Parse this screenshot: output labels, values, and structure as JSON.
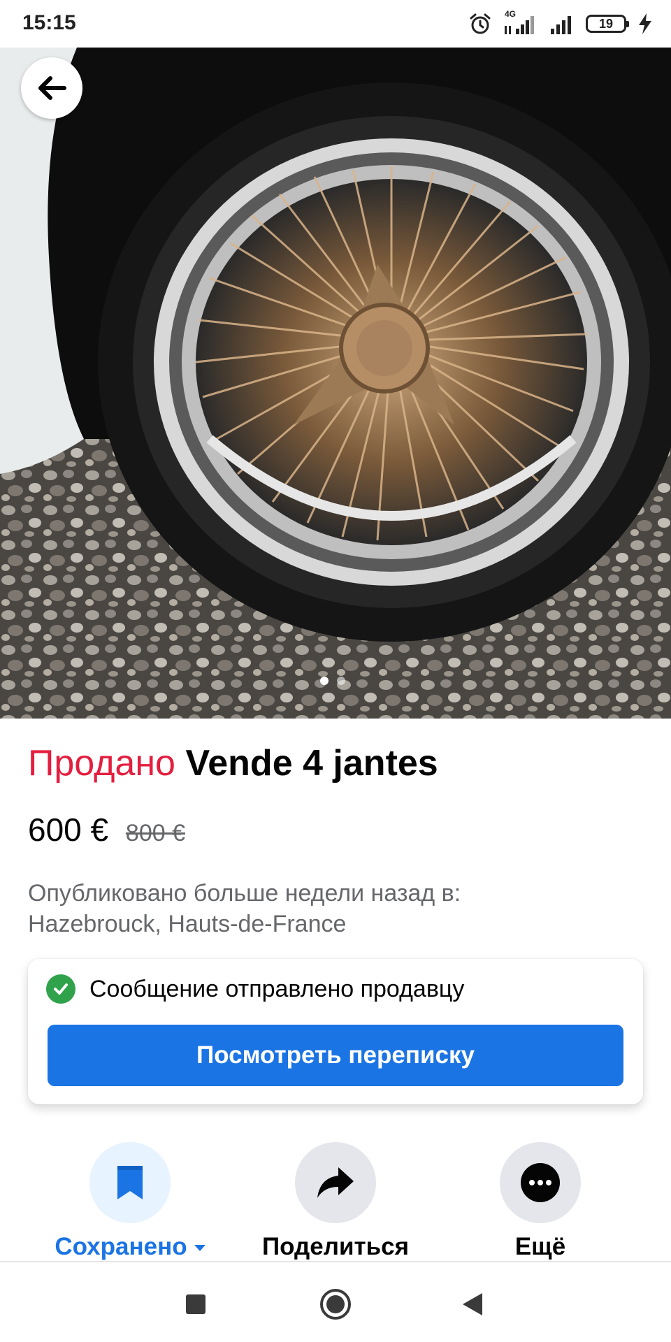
{
  "status_bar": {
    "time": "15:15",
    "network_label": "4G",
    "battery_level": "19",
    "icons": [
      "alarm-icon",
      "signal-4g-icon",
      "signal-icon",
      "battery-icon",
      "charging-icon"
    ]
  },
  "listing": {
    "photo_description_icon": "wheel-photo",
    "photo_page_count": 2,
    "photo_page_active": 1,
    "status": "Продано",
    "title": "Vende 4 jantes",
    "price": "600 €",
    "old_price": "800 €",
    "published_line1": "Опубликовано больше недели назад в:",
    "published_line2": "Hazebrouck, Hauts-de-France"
  },
  "message_card": {
    "confirmation": "Сообщение отправлено продавцу",
    "button_label": "Посмотреть переписку"
  },
  "actions": {
    "save_label": "Сохранено",
    "share_label": "Поделиться",
    "more_label": "Ещё"
  },
  "colors": {
    "sold": "#e41e3f",
    "primary": "#1b74e4",
    "success": "#31a24c",
    "secondary_text": "#65676b"
  }
}
